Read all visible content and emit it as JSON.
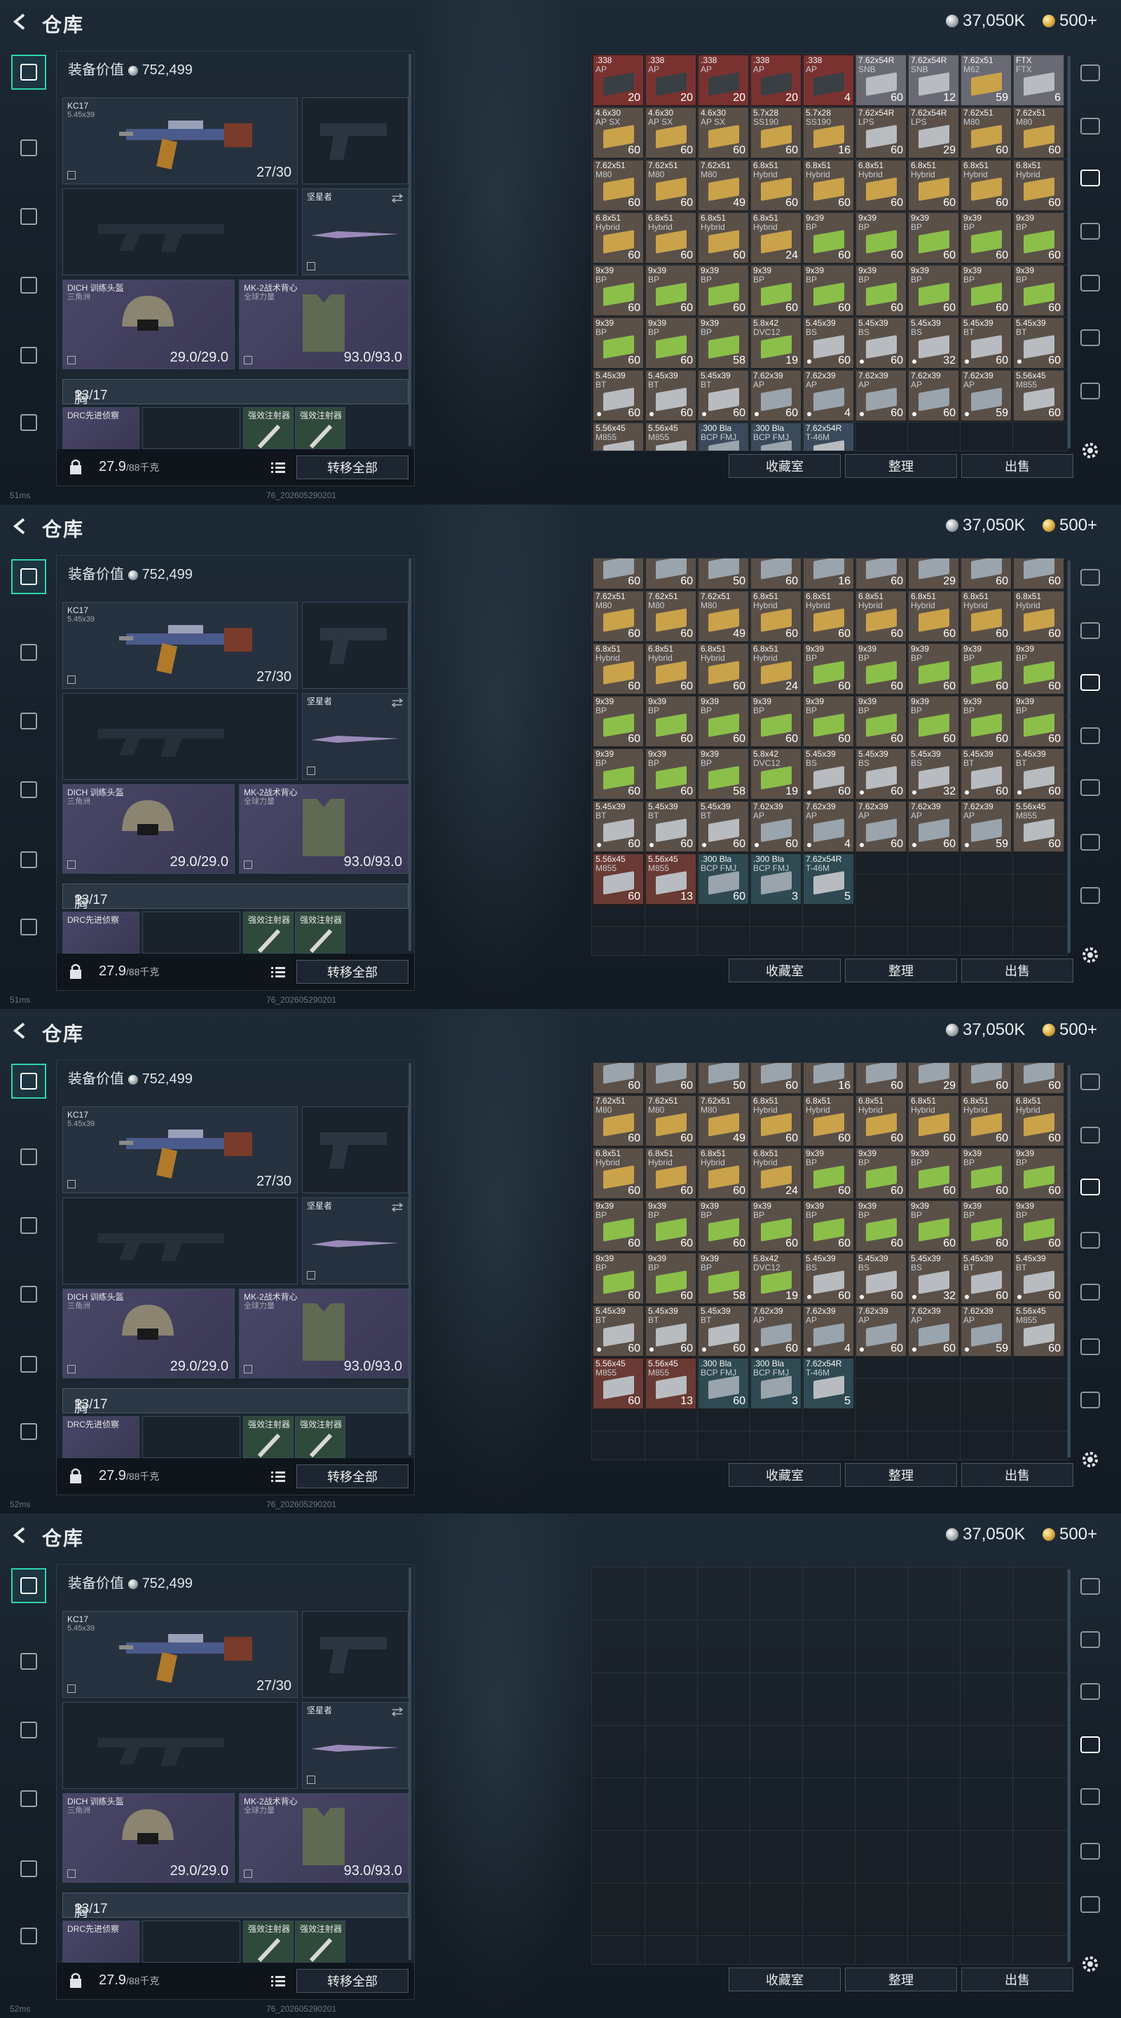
{
  "header": {
    "title": "仓库",
    "silver": "37,050K",
    "gold": "500+"
  },
  "loadout": {
    "value_label": "装备价值",
    "value": "752,499",
    "primary": {
      "name": "KC17",
      "caliber": "5.45x39",
      "ammo": "27/30"
    },
    "melee": {
      "name": "坚星者"
    },
    "helmet": {
      "name": "DICH 训练头盔",
      "sub": "三角洲",
      "durability": "29.0/29.0"
    },
    "armor": {
      "name": "MK-2战术背心",
      "sub": "全球力量",
      "durability": "93.0/93.0"
    },
    "chest_label": "胸挂：",
    "chest_value": "13/17",
    "chest_help": "?",
    "rig_item1": "DRC先进侦察",
    "rig_item2": "强效注射器",
    "rig_item3": "强效注射器",
    "weight": "27.9",
    "weight_unit": "/88千克",
    "transfer_all": "转移全部"
  },
  "actions": {
    "collection": "收藏室",
    "sort": "整理",
    "sell": "出售"
  },
  "status": {
    "latency": "51ms",
    "latency3": "52ms",
    "latency4": "52ms",
    "build": "76_202605290201"
  },
  "frames": [
    {
      "items": [
        [
          ".338",
          "AP",
          "20",
          "#7a3230"
        ],
        [
          ".338",
          "AP",
          "20",
          "#7a3230"
        ],
        [
          ".338",
          "AP",
          "20",
          "#7a3230"
        ],
        [
          ".338",
          "AP",
          "20",
          "#7a3230"
        ],
        [
          ".338",
          "AP",
          "4",
          "#7a3230"
        ],
        [
          "7.62x54R",
          "SNB",
          "60",
          "#6a6a74"
        ],
        [
          "7.62x54R",
          "SNB",
          "12",
          "#6a6a74"
        ],
        [
          "7.62x51",
          "M62",
          "59",
          "#6a6a74"
        ],
        [
          "FTX",
          "FTX",
          "6",
          "#6a6a74"
        ],
        [
          "4.6x30",
          "AP SX",
          "60",
          "#5a5048"
        ],
        [
          "4.6x30",
          "AP SX",
          "60",
          "#5a5048"
        ],
        [
          "4.6x30",
          "AP SX",
          "60",
          "#5a5048"
        ],
        [
          "5.7x28",
          "SS190",
          "60",
          "#5a5048"
        ],
        [
          "5.7x28",
          "SS190",
          "16",
          "#5a5048"
        ],
        [
          "7.62x54R",
          "LPS",
          "60",
          "#5a5048"
        ],
        [
          "7.62x54R",
          "LPS",
          "29",
          "#5a5048"
        ],
        [
          "7.62x51",
          "M80",
          "60",
          "#5a5048"
        ],
        [
          "7.62x51",
          "M80",
          "60",
          "#5a5048"
        ],
        [
          "7.62x51",
          "M80",
          "60",
          "#5a5048"
        ],
        [
          "7.62x51",
          "M80",
          "60",
          "#5a5048"
        ],
        [
          "7.62x51",
          "M80",
          "49",
          "#5a5048"
        ],
        [
          "6.8x51",
          "Hybrid",
          "60",
          "#5a5048"
        ],
        [
          "6.8x51",
          "Hybrid",
          "60",
          "#5a5048"
        ],
        [
          "6.8x51",
          "Hybrid",
          "60",
          "#5a5048"
        ],
        [
          "6.8x51",
          "Hybrid",
          "60",
          "#5a5048"
        ],
        [
          "6.8x51",
          "Hybrid",
          "60",
          "#5a5048"
        ],
        [
          "6.8x51",
          "Hybrid",
          "60",
          "#5a5048"
        ],
        [
          "6.8x51",
          "Hybrid",
          "60",
          "#5a5048"
        ],
        [
          "6.8x51",
          "Hybrid",
          "60",
          "#5a5048"
        ],
        [
          "6.8x51",
          "Hybrid",
          "60",
          "#5a5048"
        ],
        [
          "6.8x51",
          "Hybrid",
          "24",
          "#5a5048"
        ],
        [
          "9x39",
          "BP",
          "60",
          "#5a5048"
        ],
        [
          "9x39",
          "BP",
          "60",
          "#5a5048"
        ],
        [
          "9x39",
          "BP",
          "60",
          "#5a5048"
        ],
        [
          "9x39",
          "BP",
          "60",
          "#5a5048"
        ],
        [
          "9x39",
          "BP",
          "60",
          "#5a5048"
        ],
        [
          "9x39",
          "BP",
          "60",
          "#5a5048"
        ],
        [
          "9x39",
          "BP",
          "60",
          "#5a5048"
        ],
        [
          "9x39",
          "BP",
          "60",
          "#5a5048"
        ],
        [
          "9x39",
          "BP",
          "60",
          "#5a5048"
        ],
        [
          "9x39",
          "BP",
          "60",
          "#5a5048"
        ],
        [
          "9x39",
          "BP",
          "60",
          "#5a5048"
        ],
        [
          "9x39",
          "BP",
          "60",
          "#5a5048"
        ],
        [
          "9x39",
          "BP",
          "60",
          "#5a5048"
        ],
        [
          "9x39",
          "BP",
          "60",
          "#5a5048"
        ],
        [
          "9x39",
          "BP",
          "60",
          "#5a5048"
        ],
        [
          "9x39",
          "BP",
          "60",
          "#5a5048"
        ],
        [
          "9x39",
          "BP",
          "58",
          "#5a5048"
        ],
        [
          "5.8x42",
          "DVC12",
          "19",
          "#5a5048"
        ],
        [
          "5.45x39",
          "BS",
          "60",
          "#5a5048"
        ],
        [
          "5.45x39",
          "BS",
          "60",
          "#5a5048"
        ],
        [
          "5.45x39",
          "BS",
          "32",
          "#5a5048"
        ],
        [
          "5.45x39",
          "BT",
          "60",
          "#5a5048"
        ],
        [
          "5.45x39",
          "BT",
          "60",
          "#5a5048"
        ],
        [
          "5.45x39",
          "BT",
          "60",
          "#5a5048"
        ],
        [
          "5.45x39",
          "BT",
          "60",
          "#5a5048"
        ],
        [
          "5.45x39",
          "BT",
          "60",
          "#5a5048"
        ],
        [
          "7.62x39",
          "AP",
          "60",
          "#5a5048"
        ],
        [
          "7.62x39",
          "AP",
          "4",
          "#5a5048"
        ],
        [
          "7.62x39",
          "AP",
          "60",
          "#5a5048"
        ],
        [
          "7.62x39",
          "AP",
          "60",
          "#5a5048"
        ],
        [
          "7.62x39",
          "AP",
          "59",
          "#5a5048"
        ],
        [
          "5.56x45",
          "M855",
          "60",
          "#5a5048"
        ],
        [
          "5.56x45",
          "M855",
          "",
          "#5a5048"
        ],
        [
          "5.56x45",
          "M855",
          "",
          "#5a5048"
        ],
        [
          ".300 Bla",
          "BCP FMJ",
          "",
          "#3a4a5a"
        ],
        [
          ".300 Bla",
          "BCP FMJ",
          "",
          "#3a4a5a"
        ],
        [
          "7.62x54R",
          "T-46M",
          "",
          "#3a4a5a"
        ]
      ]
    },
    {
      "items": [
        [
          "",
          "",
          "60",
          "#5a5048"
        ],
        [
          "",
          "",
          "60",
          "#5a5048"
        ],
        [
          "",
          "",
          "50",
          "#5a5048"
        ],
        [
          "",
          "",
          "60",
          "#5a5048"
        ],
        [
          "",
          "",
          "16",
          "#5a5048"
        ],
        [
          "",
          "",
          "60",
          "#5a5048"
        ],
        [
          "",
          "",
          "29",
          "#5a5048"
        ],
        [
          "",
          "",
          "60",
          "#5a5048"
        ],
        [
          "",
          "",
          "60",
          "#5a5048"
        ],
        [
          "7.62x51",
          "M80",
          "60",
          "#5a5048"
        ],
        [
          "7.62x51",
          "M80",
          "60",
          "#5a5048"
        ],
        [
          "7.62x51",
          "M80",
          "49",
          "#5a5048"
        ],
        [
          "6.8x51",
          "Hybrid",
          "60",
          "#5a5048"
        ],
        [
          "6.8x51",
          "Hybrid",
          "60",
          "#5a5048"
        ],
        [
          "6.8x51",
          "Hybrid",
          "60",
          "#5a5048"
        ],
        [
          "6.8x51",
          "Hybrid",
          "60",
          "#5a5048"
        ],
        [
          "6.8x51",
          "Hybrid",
          "60",
          "#5a5048"
        ],
        [
          "6.8x51",
          "Hybrid",
          "60",
          "#5a5048"
        ],
        [
          "6.8x51",
          "Hybrid",
          "60",
          "#5a5048"
        ],
        [
          "6.8x51",
          "Hybrid",
          "60",
          "#5a5048"
        ],
        [
          "6.8x51",
          "Hybrid",
          "60",
          "#5a5048"
        ],
        [
          "6.8x51",
          "Hybrid",
          "24",
          "#5a5048"
        ],
        [
          "9x39",
          "BP",
          "60",
          "#5a5048"
        ],
        [
          "9x39",
          "BP",
          "60",
          "#5a5048"
        ],
        [
          "9x39",
          "BP",
          "60",
          "#5a5048"
        ],
        [
          "9x39",
          "BP",
          "60",
          "#5a5048"
        ],
        [
          "9x39",
          "BP",
          "60",
          "#5a5048"
        ],
        [
          "9x39",
          "BP",
          "60",
          "#5a5048"
        ],
        [
          "9x39",
          "BP",
          "60",
          "#5a5048"
        ],
        [
          "9x39",
          "BP",
          "60",
          "#5a5048"
        ],
        [
          "9x39",
          "BP",
          "60",
          "#5a5048"
        ],
        [
          "9x39",
          "BP",
          "60",
          "#5a5048"
        ],
        [
          "9x39",
          "BP",
          "60",
          "#5a5048"
        ],
        [
          "9x39",
          "BP",
          "60",
          "#5a5048"
        ],
        [
          "9x39",
          "BP",
          "60",
          "#5a5048"
        ],
        [
          "9x39",
          "BP",
          "60",
          "#5a5048"
        ],
        [
          "9x39",
          "BP",
          "60",
          "#5a5048"
        ],
        [
          "9x39",
          "BP",
          "60",
          "#5a5048"
        ],
        [
          "9x39",
          "BP",
          "58",
          "#5a5048"
        ],
        [
          "5.8x42",
          "DVC12",
          "19",
          "#5a5048"
        ],
        [
          "5.45x39",
          "BS",
          "60",
          "#5a5048"
        ],
        [
          "5.45x39",
          "BS",
          "60",
          "#5a5048"
        ],
        [
          "5.45x39",
          "BS",
          "32",
          "#5a5048"
        ],
        [
          "5.45x39",
          "BT",
          "60",
          "#5a5048"
        ],
        [
          "5.45x39",
          "BT",
          "60",
          "#5a5048"
        ],
        [
          "5.45x39",
          "BT",
          "60",
          "#5a5048"
        ],
        [
          "5.45x39",
          "BT",
          "60",
          "#5a5048"
        ],
        [
          "5.45x39",
          "BT",
          "60",
          "#5a5048"
        ],
        [
          "7.62x39",
          "AP",
          "60",
          "#5a5048"
        ],
        [
          "7.62x39",
          "AP",
          "4",
          "#5a5048"
        ],
        [
          "7.62x39",
          "AP",
          "60",
          "#5a5048"
        ],
        [
          "7.62x39",
          "AP",
          "60",
          "#5a5048"
        ],
        [
          "7.62x39",
          "AP",
          "59",
          "#5a5048"
        ],
        [
          "5.56x45",
          "M855",
          "60",
          "#5a5048"
        ],
        [
          "5.56x45",
          "M855",
          "60",
          "#6a3a34"
        ],
        [
          "5.56x45",
          "M855",
          "13",
          "#6a3a34"
        ],
        [
          ".300 Bla",
          "BCP FMJ",
          "60",
          "#2f4a52"
        ],
        [
          ".300 Bla",
          "BCP FMJ",
          "3",
          "#2f4a52"
        ],
        [
          "7.62x54R",
          "T-46M",
          "5",
          "#2f4a52"
        ]
      ]
    },
    {
      "items": [
        [
          "",
          "",
          "60",
          "#5a5048"
        ],
        [
          "",
          "",
          "60",
          "#5a5048"
        ],
        [
          "",
          "",
          "50",
          "#5a5048"
        ],
        [
          "",
          "",
          "60",
          "#5a5048"
        ],
        [
          "",
          "",
          "16",
          "#5a5048"
        ],
        [
          "",
          "",
          "60",
          "#5a5048"
        ],
        [
          "",
          "",
          "29",
          "#5a5048"
        ],
        [
          "",
          "",
          "60",
          "#5a5048"
        ],
        [
          "",
          "",
          "60",
          "#5a5048"
        ],
        [
          "7.62x51",
          "M80",
          "60",
          "#5a5048"
        ],
        [
          "7.62x51",
          "M80",
          "60",
          "#5a5048"
        ],
        [
          "7.62x51",
          "M80",
          "49",
          "#5a5048"
        ],
        [
          "6.8x51",
          "Hybrid",
          "60",
          "#5a5048"
        ],
        [
          "6.8x51",
          "Hybrid",
          "60",
          "#5a5048"
        ],
        [
          "6.8x51",
          "Hybrid",
          "60",
          "#5a5048"
        ],
        [
          "6.8x51",
          "Hybrid",
          "60",
          "#5a5048"
        ],
        [
          "6.8x51",
          "Hybrid",
          "60",
          "#5a5048"
        ],
        [
          "6.8x51",
          "Hybrid",
          "60",
          "#5a5048"
        ],
        [
          "6.8x51",
          "Hybrid",
          "60",
          "#5a5048"
        ],
        [
          "6.8x51",
          "Hybrid",
          "60",
          "#5a5048"
        ],
        [
          "6.8x51",
          "Hybrid",
          "60",
          "#5a5048"
        ],
        [
          "6.8x51",
          "Hybrid",
          "24",
          "#5a5048"
        ],
        [
          "9x39",
          "BP",
          "60",
          "#5a5048"
        ],
        [
          "9x39",
          "BP",
          "60",
          "#5a5048"
        ],
        [
          "9x39",
          "BP",
          "60",
          "#5a5048"
        ],
        [
          "9x39",
          "BP",
          "60",
          "#5a5048"
        ],
        [
          "9x39",
          "BP",
          "60",
          "#5a5048"
        ],
        [
          "9x39",
          "BP",
          "60",
          "#5a5048"
        ],
        [
          "9x39",
          "BP",
          "60",
          "#5a5048"
        ],
        [
          "9x39",
          "BP",
          "60",
          "#5a5048"
        ],
        [
          "9x39",
          "BP",
          "60",
          "#5a5048"
        ],
        [
          "9x39",
          "BP",
          "60",
          "#5a5048"
        ],
        [
          "9x39",
          "BP",
          "60",
          "#5a5048"
        ],
        [
          "9x39",
          "BP",
          "60",
          "#5a5048"
        ],
        [
          "9x39",
          "BP",
          "60",
          "#5a5048"
        ],
        [
          "9x39",
          "BP",
          "60",
          "#5a5048"
        ],
        [
          "9x39",
          "BP",
          "60",
          "#5a5048"
        ],
        [
          "9x39",
          "BP",
          "60",
          "#5a5048"
        ],
        [
          "9x39",
          "BP",
          "58",
          "#5a5048"
        ],
        [
          "5.8x42",
          "DVC12",
          "19",
          "#5a5048"
        ],
        [
          "5.45x39",
          "BS",
          "60",
          "#5a5048"
        ],
        [
          "5.45x39",
          "BS",
          "60",
          "#5a5048"
        ],
        [
          "5.45x39",
          "BS",
          "32",
          "#5a5048"
        ],
        [
          "5.45x39",
          "BT",
          "60",
          "#5a5048"
        ],
        [
          "5.45x39",
          "BT",
          "60",
          "#5a5048"
        ],
        [
          "5.45x39",
          "BT",
          "60",
          "#5a5048"
        ],
        [
          "5.45x39",
          "BT",
          "60",
          "#5a5048"
        ],
        [
          "5.45x39",
          "BT",
          "60",
          "#5a5048"
        ],
        [
          "7.62x39",
          "AP",
          "60",
          "#5a5048"
        ],
        [
          "7.62x39",
          "AP",
          "4",
          "#5a5048"
        ],
        [
          "7.62x39",
          "AP",
          "60",
          "#5a5048"
        ],
        [
          "7.62x39",
          "AP",
          "60",
          "#5a5048"
        ],
        [
          "7.62x39",
          "AP",
          "59",
          "#5a5048"
        ],
        [
          "5.56x45",
          "M855",
          "60",
          "#5a5048"
        ],
        [
          "5.56x45",
          "M855",
          "60",
          "#6a3a34"
        ],
        [
          "5.56x45",
          "M855",
          "13",
          "#6a3a34"
        ],
        [
          ".300 Bla",
          "BCP FMJ",
          "60",
          "#2f4a52"
        ],
        [
          ".300 Bla",
          "BCP FMJ",
          "3",
          "#2f4a52"
        ],
        [
          "7.62x54R",
          "T-46M",
          "5",
          "#2f4a52"
        ]
      ]
    },
    {
      "items": []
    }
  ],
  "colors": {
    "accent": "#2fd3b0",
    "box_yellow": "#c9a24a",
    "box_green": "#8bbf4a",
    "box_grey": "#b8bcc0"
  }
}
